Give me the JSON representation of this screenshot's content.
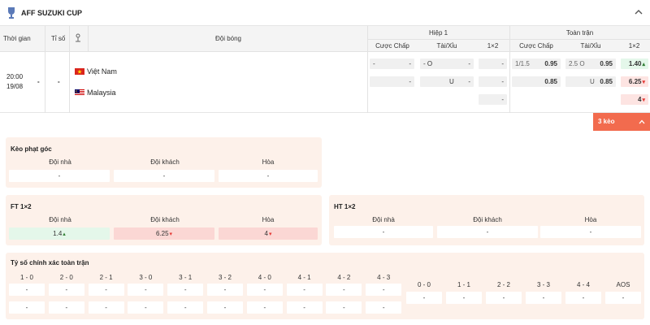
{
  "league": {
    "title": "AFF SUZUKI CUP"
  },
  "table_header": {
    "time": "Thời gian",
    "score": "Tỉ số",
    "teams": "Đội bóng",
    "half1": {
      "title": "Hiệp 1",
      "handicap": "Cược Chấp",
      "over_under": "Tài/Xỉu",
      "x12": "1×2"
    },
    "full": {
      "title": "Toàn trận",
      "handicap": "Cược Chấp",
      "over_under": "Tài/Xỉu",
      "x12": "1×2"
    }
  },
  "match": {
    "time": "20:00",
    "date": "19/08",
    "score1": "-",
    "score2": "-",
    "home": "Việt Nam",
    "away": "Malaysia",
    "h1": {
      "hc_row1": [
        "-",
        "-"
      ],
      "ou_row1": [
        "- O",
        "-"
      ],
      "x12_row1": "-",
      "hc_row2": [
        "",
        "-"
      ],
      "ou_row2": [
        "U",
        "-"
      ],
      "x12_row2": "-",
      "x12_row3": "-"
    },
    "ft": {
      "hc_row1": [
        "1/1.5",
        "0.95"
      ],
      "ou_row1": [
        "2.5 O",
        "0.95"
      ],
      "x12_row1": "1.40",
      "hc_row2": [
        "",
        "0.85"
      ],
      "ou_row2": [
        "U",
        "0.85"
      ],
      "x12_row2": "6.25",
      "x12_row3": "4"
    },
    "more_bets": "3 kèo"
  },
  "corner": {
    "title": "Kèo phạt góc",
    "labels": [
      "Đội nhà",
      "Đội khách",
      "Hòa"
    ],
    "values": [
      "-",
      "-",
      "-"
    ]
  },
  "ft1x2": {
    "title": "FT 1×2",
    "labels": [
      "Đội nhà",
      "Đội khách",
      "Hòa"
    ],
    "values": [
      "1.4",
      "6.25",
      "4"
    ]
  },
  "ht1x2": {
    "title": "HT 1×2",
    "labels": [
      "Đội nhà",
      "Đội khách",
      "Hòa"
    ],
    "values": [
      "-",
      "-",
      "-"
    ]
  },
  "correct_score": {
    "title": "Tỷ số chính xác toàn trận",
    "cols": [
      "1 - 0",
      "2 - 0",
      "2 - 1",
      "3 - 0",
      "3 - 1",
      "3 - 2",
      "4 - 0",
      "4 - 1",
      "4 - 2",
      "4 - 3"
    ],
    "row1": [
      "-",
      "-",
      "-",
      "-",
      "-",
      "-",
      "-",
      "-",
      "-",
      "-"
    ],
    "row2": [
      "-",
      "-",
      "-",
      "-",
      "-",
      "-",
      "-",
      "-",
      "-",
      "-"
    ],
    "draw_cols": [
      "0 - 0",
      "1 - 1",
      "2 - 2",
      "3 - 3",
      "4 - 4",
      "AOS"
    ],
    "draw_vals": [
      "-",
      "-",
      "-",
      "-",
      "-",
      "-"
    ]
  },
  "colors": {
    "accent": "#f26b4e",
    "panel": "#fdf1ea",
    "green": "#e4f7ea",
    "pink": "#fbd7d4"
  },
  "icons": {
    "league": "trophy-icon",
    "stats": "stats-icon",
    "home_flag": "vietnam-flag-icon",
    "away_flag": "malaysia-flag-icon",
    "collapse": "chevron-up-icon"
  }
}
